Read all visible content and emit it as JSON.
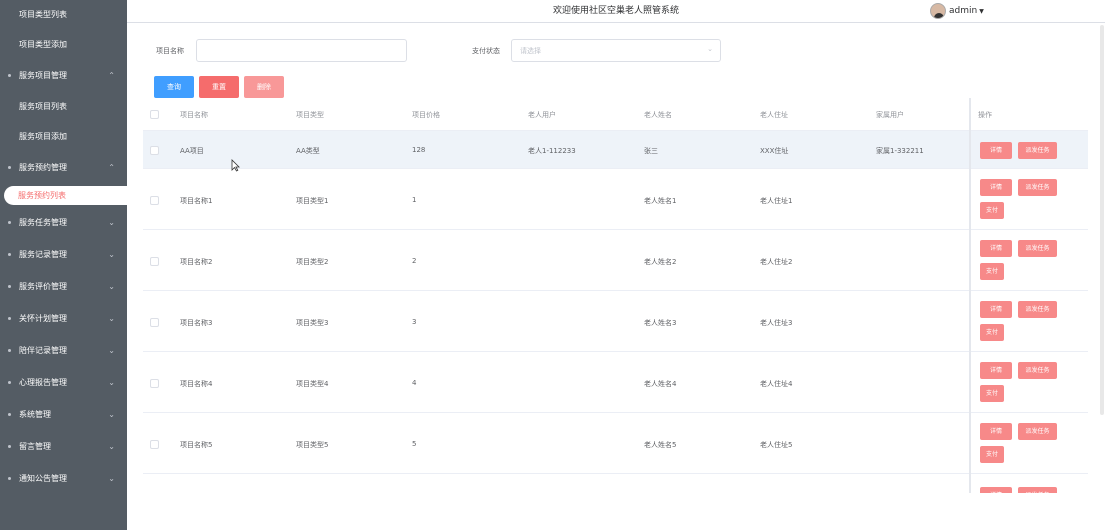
{
  "header": {
    "title": "欢迎使用社区空巢老人照管系统",
    "username": "admin"
  },
  "sidebar": {
    "top_items": [
      "项目类型列表",
      "项目类型添加"
    ],
    "groups": [
      {
        "label": "服务项目管理",
        "arrow": "^"
      },
      {
        "label": "服务项目列表",
        "sub": true
      },
      {
        "label": "服务项目添加",
        "sub": true
      },
      {
        "label": "服务预约管理",
        "arrow": "^"
      },
      {
        "label": "服务预约列表",
        "active": true
      },
      {
        "label": "服务任务管理",
        "arrow": "v"
      },
      {
        "label": "服务记录管理",
        "arrow": "v"
      },
      {
        "label": "服务评价管理",
        "arrow": "v"
      },
      {
        "label": "关怀计划管理",
        "arrow": "v"
      },
      {
        "label": "陪伴记录管理",
        "arrow": "v"
      },
      {
        "label": "心理报告管理",
        "arrow": "v"
      },
      {
        "label": "系统管理",
        "arrow": "v"
      },
      {
        "label": "留言管理",
        "arrow": "v"
      },
      {
        "label": "通知公告管理",
        "arrow": "v"
      }
    ]
  },
  "search": {
    "name_label": "项目名称",
    "name_value": "",
    "pay_label": "支付状态",
    "pay_placeholder": "请选择",
    "query_label": "查询",
    "reset_label": "重置",
    "delete_label": "删除"
  },
  "table": {
    "columns": [
      "项目名称",
      "项目类型",
      "项目价格",
      "老人用户",
      "老人姓名",
      "老人住址",
      "家属用户",
      "操作"
    ],
    "rows": [
      {
        "name": "AA项目",
        "type": "AA类型",
        "price": "128",
        "elder_user": "老人1-112233",
        "elder_name": "张三",
        "address": "XXX住址",
        "family_user": "家属1-332211"
      },
      {
        "name": "项目名称1",
        "type": "项目类型1",
        "price": "1",
        "elder_user": "",
        "elder_name": "老人姓名1",
        "address": "老人住址1",
        "family_user": ""
      },
      {
        "name": "项目名称2",
        "type": "项目类型2",
        "price": "2",
        "elder_user": "",
        "elder_name": "老人姓名2",
        "address": "老人住址2",
        "family_user": ""
      },
      {
        "name": "项目名称3",
        "type": "项目类型3",
        "price": "3",
        "elder_user": "",
        "elder_name": "老人姓名3",
        "address": "老人住址3",
        "family_user": ""
      },
      {
        "name": "项目名称4",
        "type": "项目类型4",
        "price": "4",
        "elder_user": "",
        "elder_name": "老人姓名4",
        "address": "老人住址4",
        "family_user": ""
      },
      {
        "name": "项目名称5",
        "type": "项目类型5",
        "price": "5",
        "elder_user": "",
        "elder_name": "老人姓名5",
        "address": "老人住址5",
        "family_user": ""
      }
    ],
    "op_detail": "详情",
    "op_dispatch": "派发任务",
    "op_pay": "支付"
  }
}
